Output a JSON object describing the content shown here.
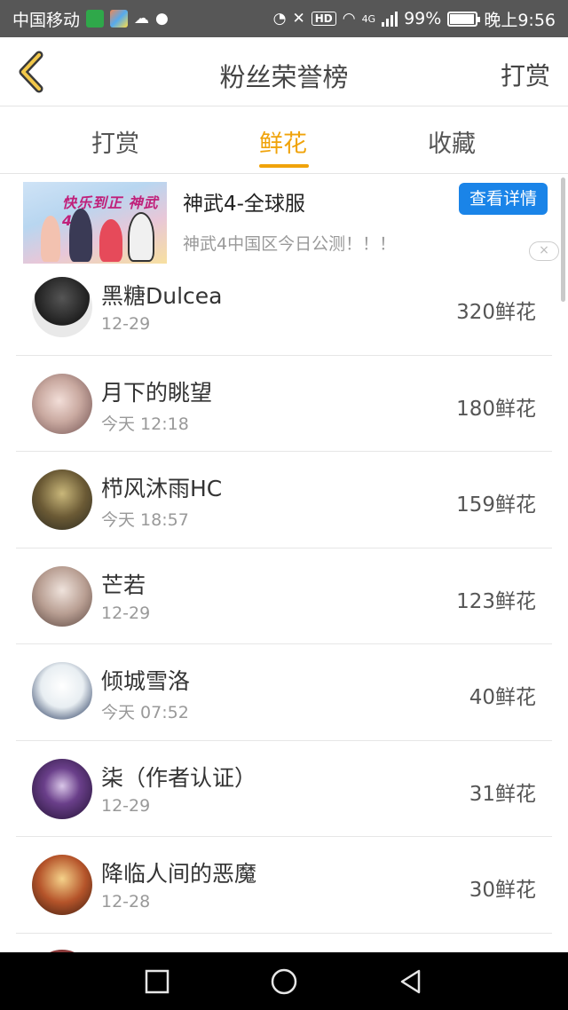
{
  "status_bar": {
    "carrier": "中国移动",
    "signal_label": "4G",
    "battery": "99%",
    "time": "晚上9:56",
    "hd_label": "HD"
  },
  "header": {
    "title": "粉丝荣誉榜",
    "action": "打赏"
  },
  "tabs": [
    {
      "label": "打赏",
      "active": false
    },
    {
      "label": "鲜花",
      "active": true
    },
    {
      "label": "收藏",
      "active": false
    }
  ],
  "ad": {
    "image_text": "快乐到正 神武4",
    "title": "神武4-全球服",
    "description": "神武4中国区今日公测！！！",
    "button": "查看详情",
    "close": "×"
  },
  "fans": [
    {
      "name": "黑糖Dulcea",
      "date": "12-29",
      "amount": "320鲜花",
      "avatar_color": "#2c2c2c"
    },
    {
      "name": "月下的眺望",
      "date": "今天 12:18",
      "amount": "180鲜花",
      "avatar_color": "#c9a9a0"
    },
    {
      "name": "栉风沐雨HC",
      "date": "今天 18:57",
      "amount": "159鲜花",
      "avatar_color": "#6b5a35"
    },
    {
      "name": "芒若",
      "date": "12-29",
      "amount": "123鲜花",
      "avatar_color": "#b89e92"
    },
    {
      "name": "倾城雪洛",
      "date": "今天 07:52",
      "amount": "40鲜花",
      "avatar_color": "#e8eef2"
    },
    {
      "name": "柒（作者认证）",
      "date": "12-29",
      "amount": "31鲜花",
      "avatar_color": "#3b1f55"
    },
    {
      "name": "降临人间的恶魔",
      "date": "12-28",
      "amount": "30鲜花",
      "avatar_color": "#b5542a"
    }
  ],
  "colors": {
    "accent": "#f0a30a",
    "ad_button": "#1a84e8",
    "status_bar": "#575757"
  }
}
